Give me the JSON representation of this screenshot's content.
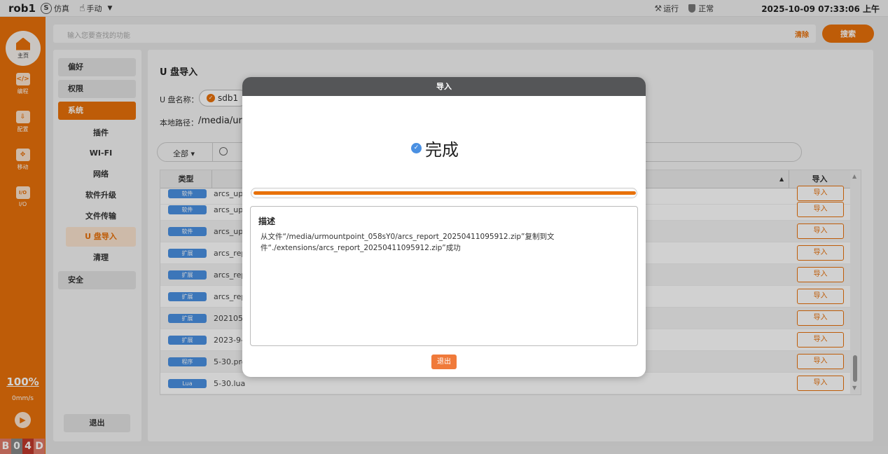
{
  "topbar": {
    "robot_name": "rob1",
    "mode_icon": "S",
    "mode_label": "仿真",
    "manual_label": "手动",
    "run_label": "运行",
    "status_label": "正常",
    "datetime": "2025-10-09 07:33:06 上午"
  },
  "rail": {
    "home": "主页",
    "items": [
      {
        "icon": "</>",
        "label": "编程",
        "icon_name": "code-icon"
      },
      {
        "icon": "⇩",
        "label": "配置",
        "icon_name": "config-icon"
      },
      {
        "icon": "✥",
        "label": "移动",
        "icon_name": "move-icon"
      },
      {
        "icon": "I/O",
        "label": "I/O",
        "icon_name": "io-icon"
      }
    ],
    "speed_percent": "100%",
    "speed_value": "0mm/s",
    "status_letters": [
      "B",
      "0",
      "4",
      "D"
    ]
  },
  "search": {
    "placeholder": "输入您要查找的功能",
    "clear_label": "清除",
    "button_label": "搜索"
  },
  "nav": {
    "items": [
      {
        "label": "偏好",
        "type": "main"
      },
      {
        "label": "权限",
        "type": "main"
      },
      {
        "label": "系统",
        "type": "main",
        "active": true
      },
      {
        "label": "插件",
        "type": "sub"
      },
      {
        "label": "WI-FI",
        "type": "sub"
      },
      {
        "label": "网络",
        "type": "sub"
      },
      {
        "label": "软件升级",
        "type": "sub"
      },
      {
        "label": "文件传输",
        "type": "sub"
      },
      {
        "label": "U 盘导入",
        "type": "sub",
        "active": true
      },
      {
        "label": "清理",
        "type": "sub"
      },
      {
        "label": "安全",
        "type": "main"
      }
    ],
    "exit_label": "退出"
  },
  "page": {
    "title": "U 盘导入",
    "udisk_label": "U 盘名称：",
    "udisk_value": "sdb1",
    "path_label": "本地路径：",
    "path_value": "/media/urm",
    "filter_all": "全部",
    "columns": {
      "type": "类型",
      "import": "导入"
    },
    "rows": [
      {
        "tag": "软件",
        "name": "arcs_upd",
        "button": "导入"
      },
      {
        "tag": "软件",
        "name": "arcs_upd",
        "button": "导入"
      },
      {
        "tag": "软件",
        "name": "arcs_upd",
        "button": "导入"
      },
      {
        "tag": "扩展",
        "name": "arcs_rep",
        "button": "导入"
      },
      {
        "tag": "扩展",
        "name": "arcs_rep",
        "button": "导入"
      },
      {
        "tag": "扩展",
        "name": "arcs_rep",
        "button": "导入"
      },
      {
        "tag": "扩展",
        "name": "2021053",
        "button": "导入"
      },
      {
        "tag": "扩展",
        "name": "2023-9-",
        "button": "导入"
      },
      {
        "tag": "程序",
        "name": "5-30.pro",
        "button": "导入"
      },
      {
        "tag": "Lua",
        "name": "5-30.lua",
        "button": "导入"
      }
    ]
  },
  "modal": {
    "title": "导入",
    "status": "完成",
    "progress": 1.0,
    "desc_title": "描述",
    "desc_text": "从文件“/media/urmountpoint_058sY0/arcs_report_20250411095912.zip”复制到文件“./extensions/arcs_report_20250411095912.zip”成功",
    "exit_label": "退出"
  },
  "colors": {
    "accent": "#e8710a",
    "tag_blue": "#4a90e2",
    "modal_header": "#555658"
  }
}
